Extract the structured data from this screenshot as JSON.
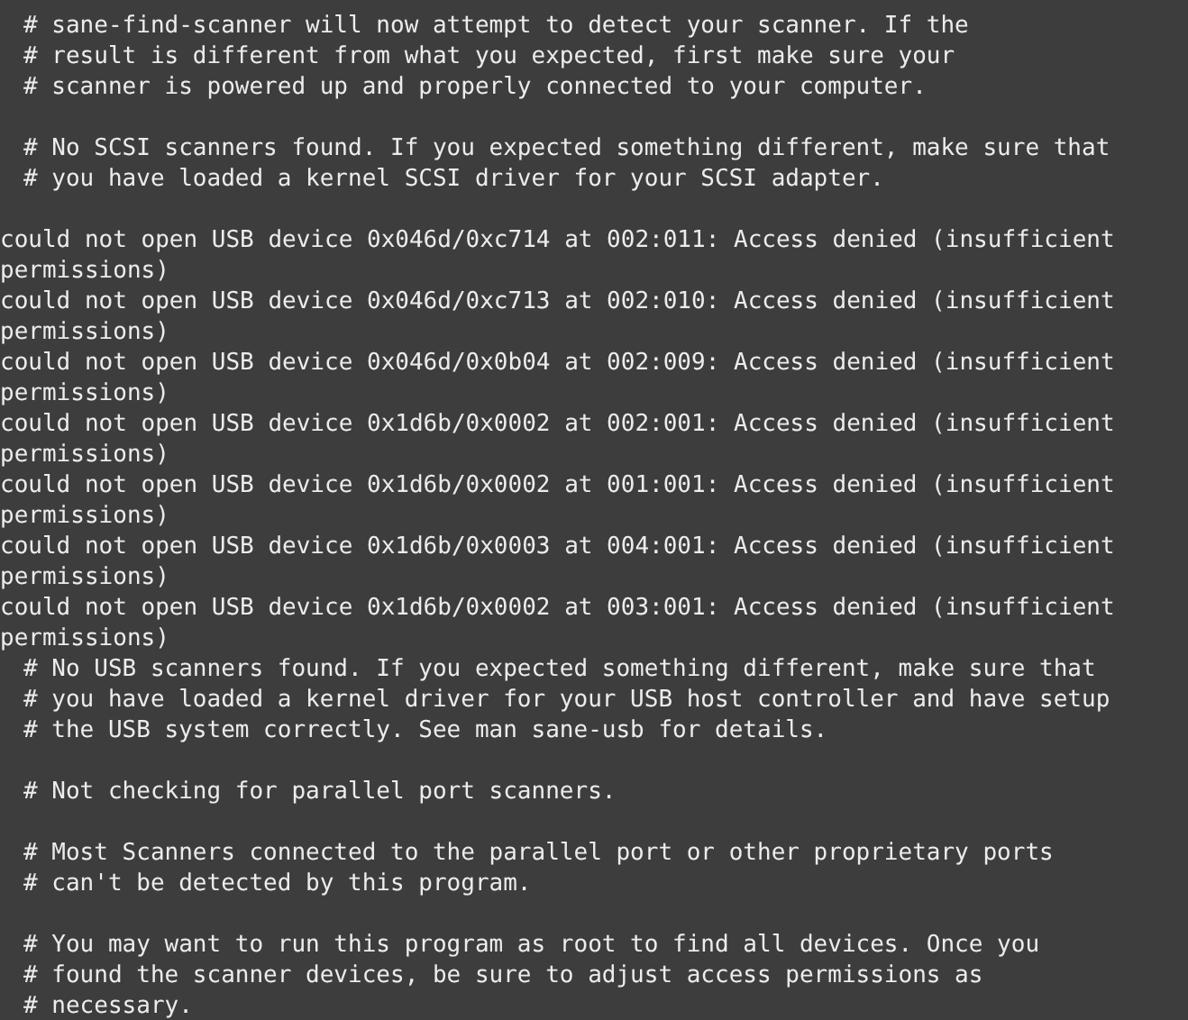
{
  "terminal": {
    "lines": [
      {
        "kind": "comment",
        "text": "# sane-find-scanner will now attempt to detect your scanner. If the"
      },
      {
        "kind": "comment",
        "text": "# result is different from what you expected, first make sure your"
      },
      {
        "kind": "comment",
        "text": "# scanner is powered up and properly connected to your computer."
      },
      {
        "kind": "blank"
      },
      {
        "kind": "comment",
        "text": "# No SCSI scanners found. If you expected something different, make sure that"
      },
      {
        "kind": "comment",
        "text": "# you have loaded a kernel SCSI driver for your SCSI adapter."
      },
      {
        "kind": "blank"
      },
      {
        "kind": "output",
        "text": "could not open USB device 0x046d/0xc714 at 002:011: Access denied (insufficient"
      },
      {
        "kind": "output",
        "text": "permissions)"
      },
      {
        "kind": "output",
        "text": "could not open USB device 0x046d/0xc713 at 002:010: Access denied (insufficient"
      },
      {
        "kind": "output",
        "text": "permissions)"
      },
      {
        "kind": "output",
        "text": "could not open USB device 0x046d/0x0b04 at 002:009: Access denied (insufficient"
      },
      {
        "kind": "output",
        "text": "permissions)"
      },
      {
        "kind": "output",
        "text": "could not open USB device 0x1d6b/0x0002 at 002:001: Access denied (insufficient"
      },
      {
        "kind": "output",
        "text": "permissions)"
      },
      {
        "kind": "output",
        "text": "could not open USB device 0x1d6b/0x0002 at 001:001: Access denied (insufficient"
      },
      {
        "kind": "output",
        "text": "permissions)"
      },
      {
        "kind": "output",
        "text": "could not open USB device 0x1d6b/0x0003 at 004:001: Access denied (insufficient"
      },
      {
        "kind": "output",
        "text": "permissions)"
      },
      {
        "kind": "output",
        "text": "could not open USB device 0x1d6b/0x0002 at 003:001: Access denied (insufficient"
      },
      {
        "kind": "output",
        "text": "permissions)"
      },
      {
        "kind": "comment",
        "text": "# No USB scanners found. If you expected something different, make sure that"
      },
      {
        "kind": "comment",
        "text": "# you have loaded a kernel driver for your USB host controller and have setup"
      },
      {
        "kind": "comment",
        "text": "# the USB system correctly. See man sane-usb for details."
      },
      {
        "kind": "blank"
      },
      {
        "kind": "comment",
        "text": "# Not checking for parallel port scanners."
      },
      {
        "kind": "blank"
      },
      {
        "kind": "comment",
        "text": "# Most Scanners connected to the parallel port or other proprietary ports"
      },
      {
        "kind": "comment",
        "text": "# can't be detected by this program."
      },
      {
        "kind": "blank"
      },
      {
        "kind": "comment",
        "text": "# You may want to run this program as root to find all devices. Once you"
      },
      {
        "kind": "comment",
        "text": "# found the scanner devices, be sure to adjust access permissions as"
      },
      {
        "kind": "comment",
        "text": "# necessary."
      }
    ]
  }
}
